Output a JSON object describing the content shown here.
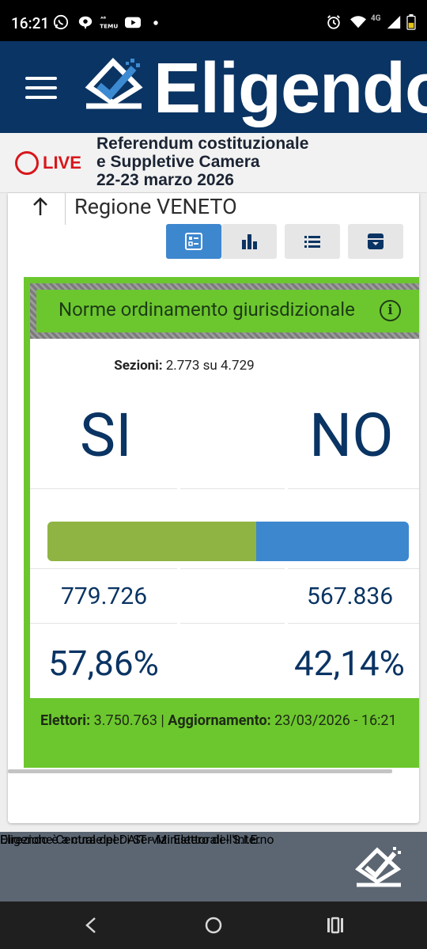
{
  "status_bar": {
    "time": "16:21",
    "icons_left": [
      "whatsapp-icon",
      "chat-bubble-icon",
      "temu-icon",
      "youtube-icon",
      "dot-icon"
    ],
    "icons_right": [
      "alarm-icon",
      "wifi-icon",
      "signal-4g-icon",
      "battery-icon"
    ],
    "network_label": "4G"
  },
  "header": {
    "app_name": "Eligendo",
    "brand_color": "#0a3463"
  },
  "live_banner": {
    "live_label": "LIVE",
    "title_line1": "Referendum costituzionale",
    "title_line2": "e Suppletive Camera",
    "title_line3": "22-23 marzo 2026"
  },
  "region": {
    "title": "Regione VENETO"
  },
  "view_tabs": [
    {
      "name": "summary-view",
      "icon": "list-grid-icon",
      "active": true
    },
    {
      "name": "chart-view",
      "icon": "bar-chart-icon",
      "active": false
    },
    {
      "name": "list-view",
      "icon": "list-icon",
      "active": false
    },
    {
      "name": "archive-view",
      "icon": "archive-icon",
      "active": false
    }
  ],
  "referendum": {
    "title": "Norme ordinamento giurisdizionale",
    "sezioni_label": "Sezioni:",
    "sezioni_value": "2.773 su 4.729",
    "yes_label": "SI",
    "no_label": "NO",
    "yes_votes": "779.726",
    "no_votes": "567.836",
    "yes_percent_text": "57,86%",
    "no_percent_text": "42,14%",
    "yes_share": 57.86,
    "no_share": 42.14,
    "yes_color": "#8fb443",
    "no_color": "#3d87cf",
    "elettori_label": "Elettori:",
    "elettori_value": "3.750.763",
    "separator": "|",
    "aggiornamento_label": "Aggiornamento:",
    "aggiornamento_value": "23/03/2026 - 16:21"
  },
  "footer": {
    "line1": "Eligendo è a cura del DAIT - Ministero dell'Interno",
    "line2": "Direzione Centrale per i Servizi Elettorali - S.I.E."
  },
  "nav_bar": {
    "buttons": [
      "back-icon",
      "home-icon",
      "recents-icon"
    ]
  }
}
